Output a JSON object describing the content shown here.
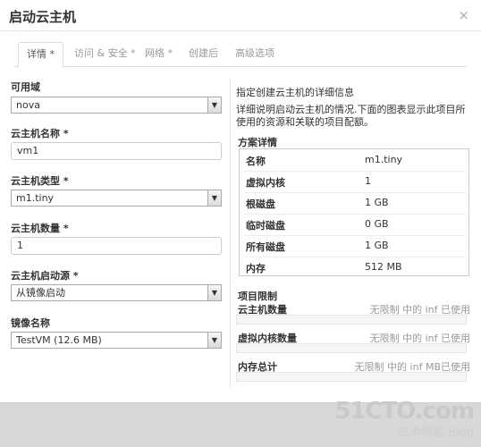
{
  "modal": {
    "title": "启动云主机",
    "close_label": "×"
  },
  "tabs": [
    {
      "label": "详情 *"
    },
    {
      "label": "访问 & 安全 *"
    },
    {
      "label": "网络 *"
    },
    {
      "label": "创建后"
    },
    {
      "label": "高级选项"
    }
  ],
  "form": {
    "availability_zone": {
      "label": "可用域",
      "value": "nova"
    },
    "instance_name": {
      "label": "云主机名称",
      "required": "*",
      "value": "vm1"
    },
    "flavor": {
      "label": "云主机类型",
      "required": "*",
      "value": "m1.tiny"
    },
    "count": {
      "label": "云主机数量",
      "required": "*",
      "value": "1"
    },
    "boot_source": {
      "label": "云主机启动源",
      "required": "*",
      "value": "从镜像启动"
    },
    "image_name": {
      "label": "镜像名称",
      "value": "TestVM (12.6 MB)"
    }
  },
  "info": {
    "description_1": "指定创建云主机的详细信息",
    "description_2": "详细说明启动云主机的情况.下面的图表显示此项目所使用的资源和关联的项目配额。"
  },
  "flavor_details": {
    "title": "方案详情",
    "rows": [
      {
        "key": "名称",
        "value": "m1.tiny"
      },
      {
        "key": "虚拟内核",
        "value": "1"
      },
      {
        "key": "根磁盘",
        "value": "1 GB"
      },
      {
        "key": "临时磁盘",
        "value": "0 GB"
      },
      {
        "key": "所有磁盘",
        "value": "1 GB"
      },
      {
        "key": "内存",
        "value": "512 MB"
      }
    ]
  },
  "project_limits": {
    "title": "项目限制",
    "items": [
      {
        "label": "云主机数量",
        "text": "无限制 中的 inf 已使用",
        "used_fraction": 0
      },
      {
        "label": "虚拟内核数量",
        "text": "无限制 中的 inf 已使用",
        "used_fraction": 0
      },
      {
        "label": "内存总计",
        "text": "无限制 中的 inf MB已使用",
        "used_fraction": 0
      }
    ]
  },
  "watermark": {
    "main": "51CTO.com",
    "sub": "技术博客 Blog"
  }
}
